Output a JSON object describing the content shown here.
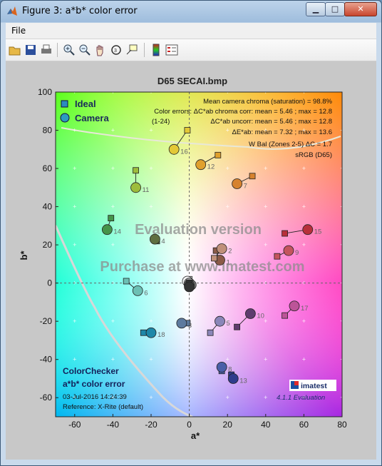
{
  "window": {
    "title": "Figure 3: a*b* color error",
    "menu": [
      "File"
    ],
    "buttons": {
      "minimize": "▁",
      "maximize": "□",
      "close": "✕"
    }
  },
  "toolbar": {
    "icons": [
      "open-folder-icon",
      "save-icon",
      "print-icon",
      "zoom-in-icon",
      "zoom-out-icon",
      "pan-hand-icon",
      "rotate-3d-icon",
      "data-cursor-icon",
      "colorbar-icon",
      "legend-icon"
    ]
  },
  "chart_data": {
    "type": "scatter",
    "title": "D65 SECAI.bmp",
    "xlabel": "a*",
    "ylabel": "b*",
    "xlim": [
      -70,
      80
    ],
    "ylim": [
      -70,
      100
    ],
    "xticks": [
      -60,
      -40,
      -20,
      0,
      20,
      40,
      60,
      80
    ],
    "yticks": [
      -60,
      -40,
      -20,
      0,
      20,
      40,
      60,
      80,
      100
    ],
    "legend": {
      "position": "top-left",
      "entries": [
        "Ideal",
        "Camera"
      ]
    },
    "info_lines": [
      "Mean camera chroma (saturation) = 98.8%",
      "Color errors: ΔC*ab chroma corr:  mean = 5.46 ;  max = 12.8",
      "(1-24)",
      "ΔC*ab uncorr:  mean = 5.46 ;  max = 12.8",
      "ΔE*ab:  mean = 7.32 ;  max = 13.6",
      "W Bal (Zones 2-5) ΔC = 1.7",
      "sRGB (D65)"
    ],
    "watermark": [
      "Evaluation version",
      "Purchase at www.imatest.com"
    ],
    "footer_left": [
      "ColorChecker",
      "a*b* color error",
      "03-Jul-2016 14:24:39",
      "Reference: X-Rite (default)"
    ],
    "logo": "imatest",
    "version": "4.1.1  Evaluation",
    "patches": [
      {
        "id": "1",
        "ideal": [
          14,
          17
        ],
        "camera": [
          16,
          12
        ],
        "color": "#8b5a48"
      },
      {
        "id": "2",
        "ideal": [
          13,
          13
        ],
        "camera": [
          17,
          18
        ],
        "color": "#c0907a"
      },
      {
        "id": "3",
        "ideal": [
          -1,
          -21
        ],
        "camera": [
          -4,
          -21
        ],
        "color": "#5d7a9e"
      },
      {
        "id": "4",
        "ideal": [
          -17,
          22
        ],
        "camera": [
          -18,
          23
        ],
        "color": "#5f6e40"
      },
      {
        "id": "5",
        "ideal": [
          11,
          -26
        ],
        "camera": [
          16,
          -20
        ],
        "color": "#8a86b8"
      },
      {
        "id": "6",
        "ideal": [
          -33,
          1
        ],
        "camera": [
          -27,
          -4
        ],
        "color": "#6cc0b4"
      },
      {
        "id": "7",
        "ideal": [
          33,
          56
        ],
        "camera": [
          25,
          52
        ],
        "color": "#d6822e"
      },
      {
        "id": "8",
        "ideal": [
          17,
          -46
        ],
        "camera": [
          17,
          -44
        ],
        "color": "#4a5fa8"
      },
      {
        "id": "9",
        "ideal": [
          46,
          14
        ],
        "camera": [
          52,
          17
        ],
        "color": "#c4545e"
      },
      {
        "id": "10",
        "ideal": [
          25,
          -23
        ],
        "camera": [
          32,
          -16
        ],
        "color": "#5e3c6e"
      },
      {
        "id": "11",
        "ideal": [
          -28,
          59
        ],
        "camera": [
          -28,
          50
        ],
        "color": "#9dbc3c"
      },
      {
        "id": "12",
        "ideal": [
          15,
          67
        ],
        "camera": [
          6,
          62
        ],
        "color": "#e0a02e"
      },
      {
        "id": "13",
        "ideal": [
          22,
          -48
        ],
        "camera": [
          23,
          -50
        ],
        "color": "#2f3c8c"
      },
      {
        "id": "14",
        "ideal": [
          -41,
          34
        ],
        "camera": [
          -43,
          28
        ],
        "color": "#45944a"
      },
      {
        "id": "15",
        "ideal": [
          50,
          26
        ],
        "camera": [
          62,
          28
        ],
        "color": "#b8303a"
      },
      {
        "id": "16",
        "ideal": [
          -1,
          80
        ],
        "camera": [
          -8,
          70
        ],
        "color": "#e3c836"
      },
      {
        "id": "17",
        "ideal": [
          50,
          -17
        ],
        "camera": [
          55,
          -12
        ],
        "color": "#bc5498"
      },
      {
        "id": "18",
        "ideal": [
          -24,
          -26
        ],
        "camera": [
          -20,
          -26
        ],
        "color": "#1d88a8"
      },
      {
        "id": "19",
        "ideal": [
          0,
          2
        ],
        "camera": [
          -1,
          1
        ],
        "color": "#f2f2f2"
      },
      {
        "id": "20",
        "ideal": [
          0,
          0
        ],
        "camera": [
          0,
          -1
        ],
        "color": "#c8c8c8"
      },
      {
        "id": "21",
        "ideal": [
          0,
          0
        ],
        "camera": [
          0,
          0
        ],
        "color": "#a0a0a0"
      },
      {
        "id": "22",
        "ideal": [
          0,
          0
        ],
        "camera": [
          1,
          -1
        ],
        "color": "#7a7a7a"
      },
      {
        "id": "23",
        "ideal": [
          0,
          0
        ],
        "camera": [
          0,
          -1
        ],
        "color": "#555555"
      },
      {
        "id": "24",
        "ideal": [
          0,
          0
        ],
        "camera": [
          0,
          -2
        ],
        "color": "#333333"
      }
    ]
  }
}
